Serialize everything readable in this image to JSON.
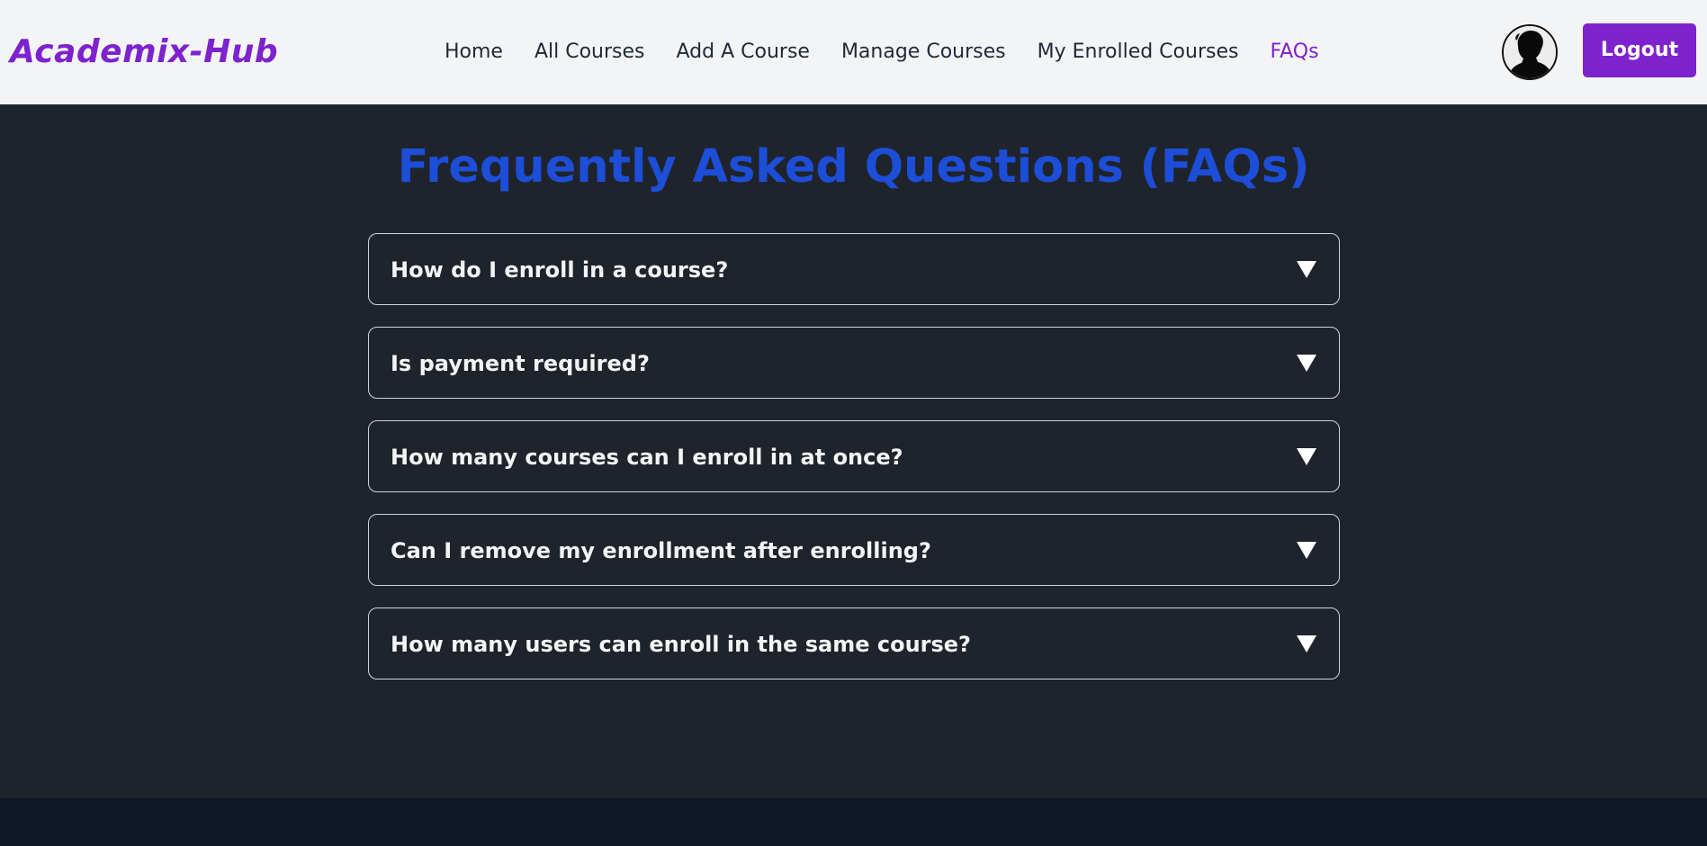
{
  "brand": {
    "name": "Academix-Hub",
    "color": "#7e22ce"
  },
  "nav": {
    "items": [
      {
        "label": "Home",
        "active": false
      },
      {
        "label": "All Courses",
        "active": false
      },
      {
        "label": "Add A Course",
        "active": false
      },
      {
        "label": "Manage Courses",
        "active": false
      },
      {
        "label": "My Enrolled Courses",
        "active": false
      },
      {
        "label": "FAQs",
        "active": true
      }
    ],
    "avatar_icon": "user-avatar-icon",
    "logout_label": "Logout"
  },
  "main": {
    "title": "Frequently Asked Questions (FAQs)",
    "faqs": [
      {
        "question": "How do I enroll in a course?",
        "expanded": false
      },
      {
        "question": "Is payment required?",
        "expanded": false
      },
      {
        "question": "How many courses can I enroll in at once?",
        "expanded": false
      },
      {
        "question": "Can I remove my enrollment after enrolling?",
        "expanded": false
      },
      {
        "question": "How many users can enroll in the same course?",
        "expanded": false
      }
    ],
    "expand_icon": "triangle-down-icon"
  },
  "colors": {
    "accent": "#7e22ce",
    "title_blue": "#1d4ed8",
    "page_bg": "#1f232b",
    "nav_bg": "#f3f4f6",
    "footer_bg": "#111827"
  }
}
